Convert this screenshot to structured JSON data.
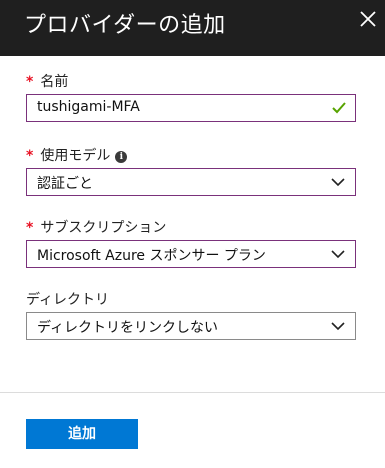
{
  "header": {
    "title": "プロバイダーの追加",
    "close_icon": "close-icon"
  },
  "required_mark": "*",
  "fields": {
    "name": {
      "label": "名前",
      "value": "tushigami-MFA",
      "status_icon": "checkmark-icon"
    },
    "usage_model": {
      "label": "使用モデル",
      "info_icon": "info-icon",
      "info_glyph": "i",
      "value": "認証ごと"
    },
    "subscription": {
      "label": "サブスクリプション",
      "value": "Microsoft Azure スポンサー プラン"
    },
    "directory": {
      "label": "ディレクトリ",
      "value": "ディレクトリをリンクしない"
    }
  },
  "footer": {
    "add_label": "追加"
  },
  "colors": {
    "header_bg": "#1f1f1f",
    "required": "#e81123",
    "focus_border": "#7a317b",
    "check": "#57a300",
    "button": "#0078d4"
  }
}
